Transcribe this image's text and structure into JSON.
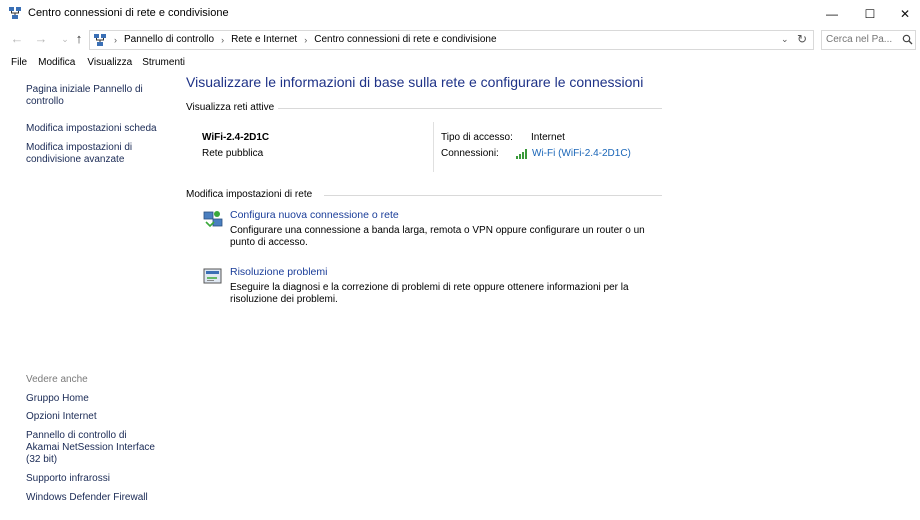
{
  "window": {
    "title": "Centro connessioni di rete e condivisione",
    "minimize_glyph": "—",
    "maximize_glyph": "☐",
    "close_glyph": "✕"
  },
  "address": {
    "crumbs": [
      "Pannello di controllo",
      "Rete e Internet",
      "Centro connessioni di rete e condivisione"
    ],
    "search_placeholder": "Cerca nel Pa..."
  },
  "menu": {
    "items": [
      "File",
      "Modifica",
      "Visualizza",
      "Strumenti"
    ]
  },
  "sidebar": {
    "links": [
      "Pagina iniziale Pannello di controllo",
      "Modifica impostazioni scheda",
      "Modifica impostazioni di condivisione avanzate"
    ],
    "see_also_label": "Vedere anche",
    "see_also": [
      "Gruppo Home",
      "Opzioni Internet",
      "Pannello di controllo di Akamai NetSession Interface (32 bit)",
      "Supporto infrarossi",
      "Windows Defender Firewall"
    ]
  },
  "main": {
    "heading": "Visualizzare le informazioni di base sulla rete e configurare le connessioni",
    "active_networks_label": "Visualizza reti attive",
    "network": {
      "name": "WiFi-2.4-2D1C",
      "category": "Rete pubblica",
      "access_type_label": "Tipo di accesso:",
      "access_type_value": "Internet",
      "connections_label": "Connessioni:",
      "connection_link": "Wi-Fi (WiFi-2.4-2D1C)"
    },
    "change_settings_label": "Modifica impostazioni di rete",
    "tasks": [
      {
        "title": "Configura nuova connessione o rete",
        "description": "Configurare una connessione a banda larga, remota o VPN oppure configurare un router o un punto di accesso.",
        "icon": "network-setup-icon"
      },
      {
        "title": "Risoluzione problemi",
        "description": "Eseguire la diagnosi e la correzione di problemi di rete oppure ottenere informazioni per la risoluzione dei problemi.",
        "icon": "troubleshoot-icon"
      }
    ]
  },
  "colors": {
    "heading": "#1e3287",
    "link": "#1a66b8",
    "sidebar_link": "#1a2a55"
  }
}
